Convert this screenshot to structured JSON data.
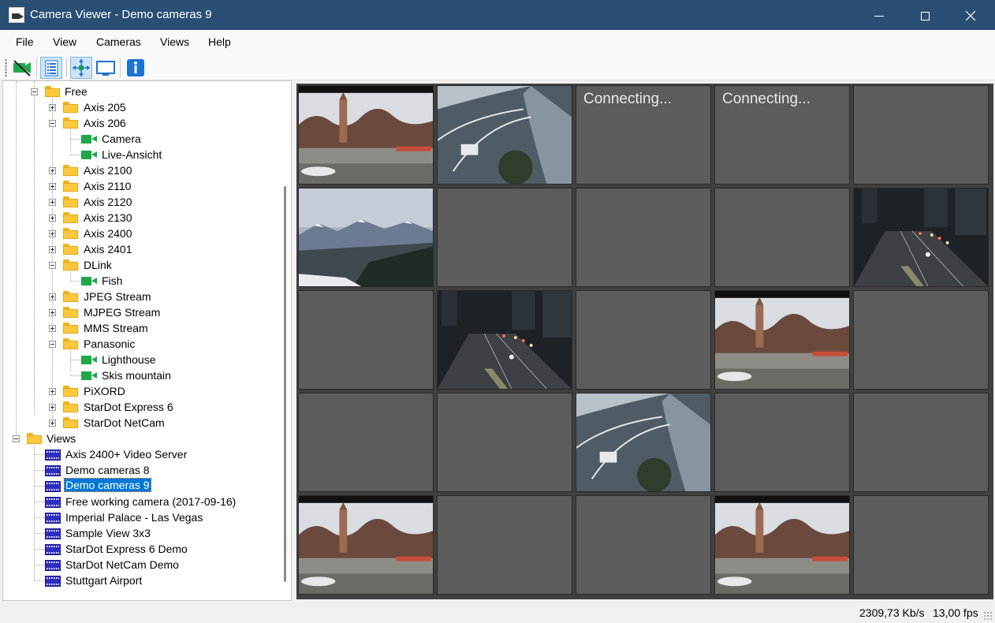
{
  "window": {
    "title": "Camera Viewer - Demo cameras 9"
  },
  "menu": [
    "File",
    "View",
    "Cameras",
    "Views",
    "Help"
  ],
  "toolbar": {
    "icons": [
      "camera-off-icon",
      "list-icon",
      "fullscreen-icon",
      "monitor-icon",
      "info-icon"
    ]
  },
  "tree": {
    "free": "Free",
    "axis205": "Axis 205",
    "axis206": "Axis 206",
    "camera": "Camera",
    "live": "Live-Ansicht",
    "axis2100": "Axis 2100",
    "axis2110": "Axis 2110",
    "axis2120": "Axis 2120",
    "axis2130": "Axis 2130",
    "axis2400": "Axis 2400",
    "axis2401": "Axis 2401",
    "dlink": "DLink",
    "fish": "Fish",
    "jpeg": "JPEG Stream",
    "mjpeg": "MJPEG Stream",
    "mms": "MMS Stream",
    "panasonic": "Panasonic",
    "lighthouse": "Lighthouse",
    "skis": "Skis mountain",
    "pixord": "PiXORD",
    "stardot6": "StarDot Express 6",
    "stardotnet": "StarDot NetCam",
    "views": "Views",
    "v1": "Axis 2400+ Video Server",
    "v2": "Demo cameras 8",
    "v3": "Demo cameras 9",
    "v4": "Free working camera (2017-09-16)",
    "v5": "Imperial Palace - Las Vegas",
    "v6": "Sample View 3x3",
    "v7": "StarDot Express 6 Demo",
    "v8": "StarDot NetCam Demo",
    "v9": "Stuttgart Airport"
  },
  "grid": {
    "connecting_1": "Connecting...",
    "connecting_2": "Connecting..."
  },
  "status": {
    "bitrate": "2309,73 Kb/s",
    "fps": "13,00 fps"
  }
}
